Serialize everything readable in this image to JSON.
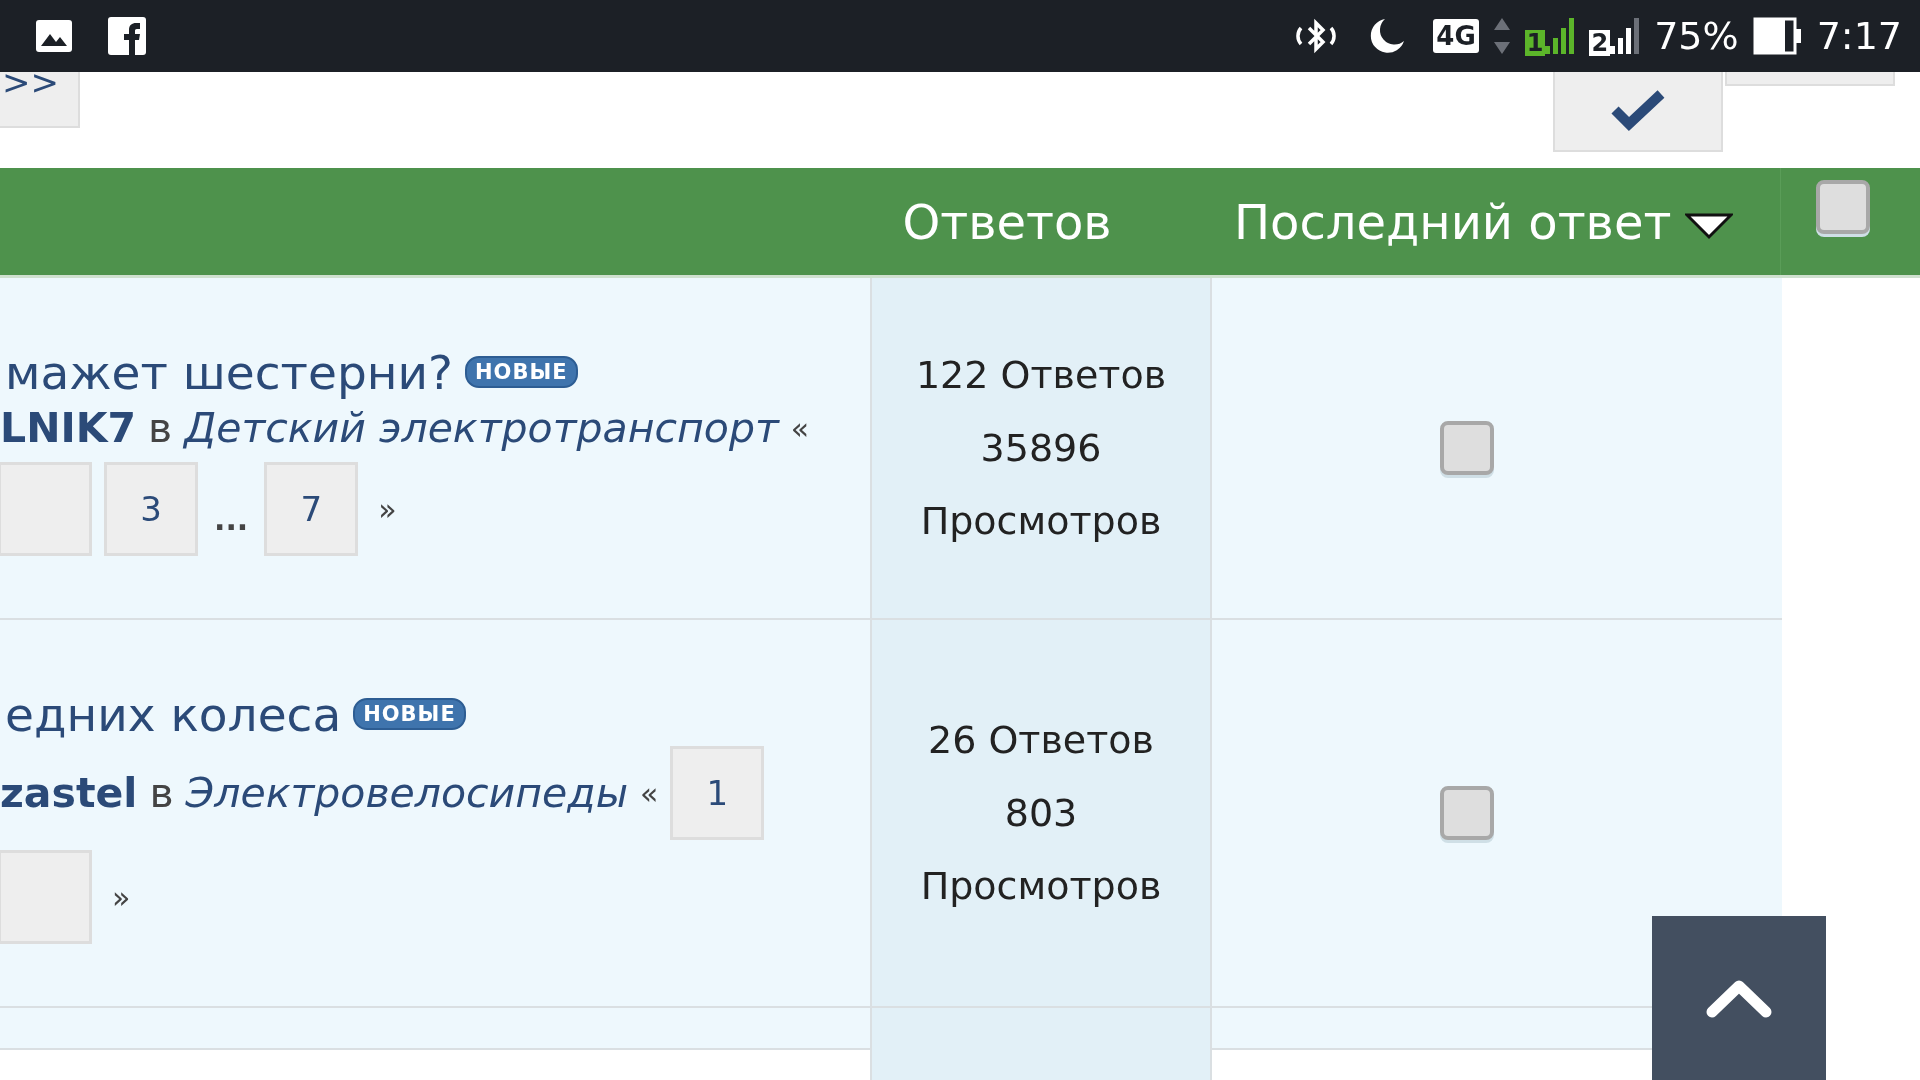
{
  "status_bar": {
    "network": "4G",
    "sim_1": "1",
    "sim_2": "2",
    "battery": "75%",
    "time": "7:17"
  },
  "toolbar": {
    "prev_button": ">>"
  },
  "table": {
    "columns": [
      {
        "label": "Ответов",
        "sorted": false
      },
      {
        "label": "Последний ответ",
        "sorted": true
      }
    ],
    "select_all": {
      "checked": false
    },
    "rows": [
      {
        "title": "мажет шестерни?",
        "badge": "НОВЫЕ",
        "author": "LNIK7",
        "preposition": "в",
        "forum": "Детский электротранспорт",
        "separator": "«",
        "pages": [
          {
            "kind": "stub"
          },
          {
            "kind": "page",
            "label": "3"
          },
          {
            "kind": "ellipsis",
            "label": "..."
          },
          {
            "kind": "page",
            "label": "7"
          },
          {
            "kind": "next",
            "label": "»"
          }
        ],
        "replies": "122 Ответов",
        "views": "35896",
        "views_label": "Просмотров",
        "checked": false
      },
      {
        "title": "едних колеса",
        "badge": "НОВЫЕ",
        "author": "zastel",
        "preposition": "в",
        "forum": "Электровелосипеды",
        "separator": "«",
        "pages": [
          {
            "kind": "page",
            "label": "1"
          },
          {
            "kind": "stub"
          },
          {
            "kind": "next",
            "label": "»"
          }
        ],
        "replies": "26 Ответов",
        "views": "803",
        "views_label": "Просмотров",
        "checked": false
      }
    ]
  }
}
